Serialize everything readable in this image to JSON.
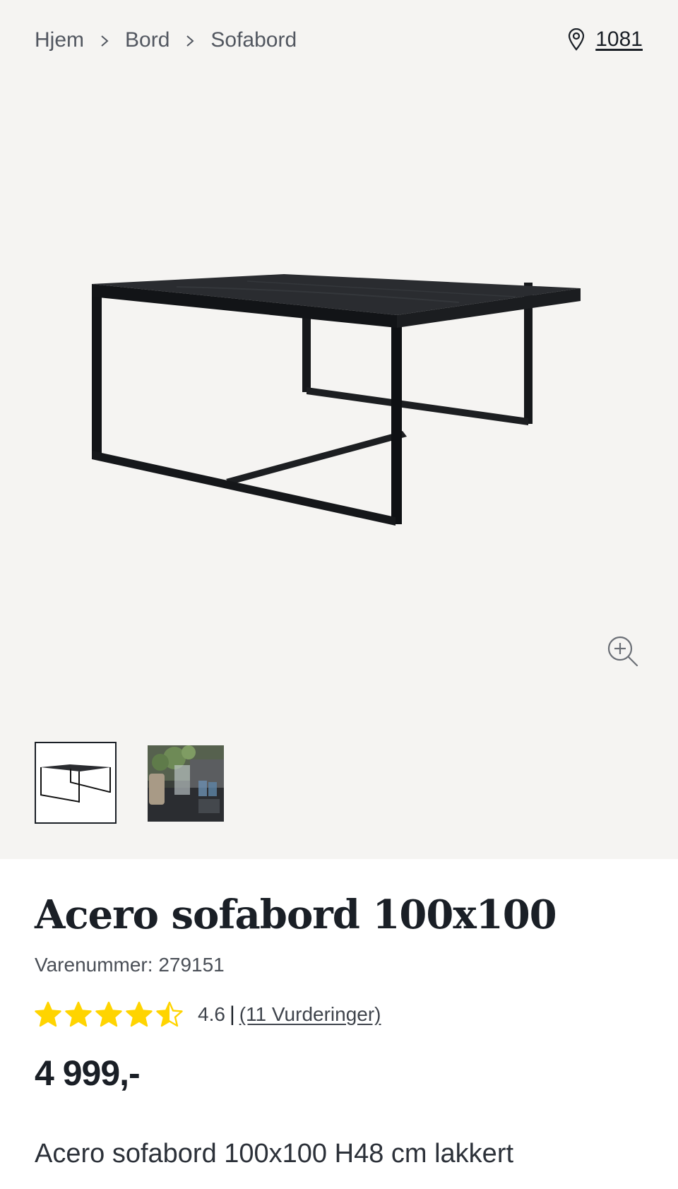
{
  "breadcrumb": {
    "items": [
      "Hjem",
      "Bord",
      "Sofabord"
    ]
  },
  "store": {
    "icon": "location-pin-icon",
    "number": "1081"
  },
  "gallery": {
    "zoom_icon": "zoom-in-icon",
    "thumbnails": [
      {
        "name": "thumbnail-table-product",
        "selected": true
      },
      {
        "name": "thumbnail-table-lifestyle",
        "selected": false
      }
    ]
  },
  "product": {
    "title": "Acero sofabord 100x100",
    "sku_label": "Varenummer: 279151",
    "rating": {
      "score": "4.6",
      "separator": "|",
      "reviews": "(11 Vurderinger)",
      "stars_value": 4.6,
      "star_color": "#ffd400"
    },
    "price": "4 999,-",
    "description": "Acero sofabord 100x100 H48 cm lakkert"
  }
}
